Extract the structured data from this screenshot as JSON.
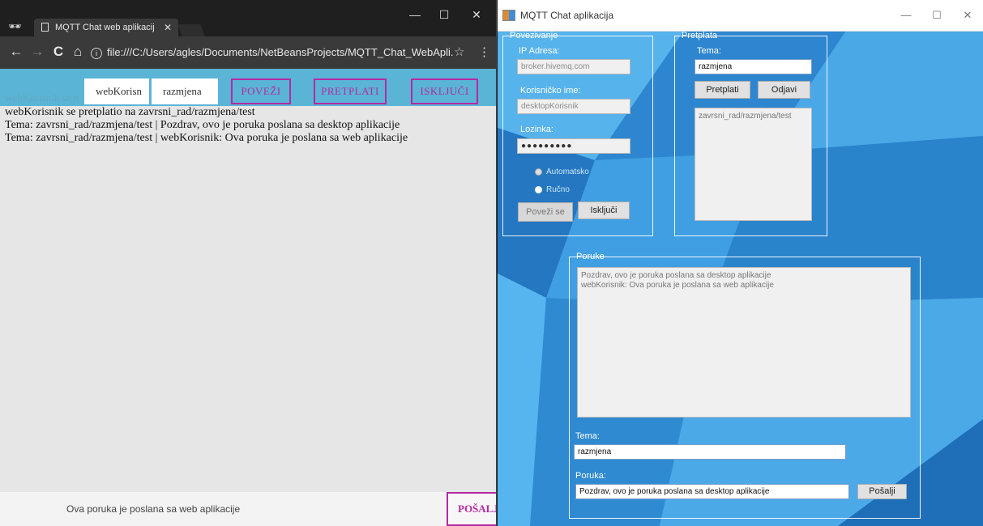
{
  "browser": {
    "tab_title": "MQTT Chat web aplikacij",
    "tab_close": "✕",
    "url": "file:///C:/Users/agles/Documents/NetBeansProjects/MQTT_Chat_WebApli...",
    "win_minimize": "—",
    "win_maximize": "☐",
    "win_close": "✕",
    "back_glyph": "←",
    "forward_glyph": "→",
    "reload_glyph": "C",
    "home_glyph": "⌂",
    "info_glyph": "i",
    "star_glyph": "☆",
    "menu_glyph": "⋮",
    "incognito_glyph": "🕶"
  },
  "webapp": {
    "ghost_text": "webKorisnik se p",
    "username_value": "webKorisn",
    "topic_value": "razmjena",
    "connect_label": "POVEŽI",
    "subscribe_label": "PRETPLATI",
    "disconnect_label": "ISKLJUČI",
    "messages": [
      "webKorisnik se pretplatio na zavrsni_rad/razmjena/test",
      "Tema: zavrsni_rad/razmjena/test | Pozdrav, ovo je poruka poslana sa desktop aplikacije",
      "Tema: zavrsni_rad/razmjena/test | webKorisnik: Ova poruka je poslana sa web aplikacije"
    ],
    "message_input_value": "Ova poruka je poslana sa web aplikacije",
    "send_label": "POŠALJI"
  },
  "desktop": {
    "title": "MQTT Chat aplikacija",
    "win_minimize": "—",
    "win_maximize": "☐",
    "win_close": "✕",
    "connection_group": {
      "title": "Povezivanje",
      "ip_label": "IP Adresa:",
      "ip_value": "broker.hivemq.com",
      "username_label": "Korisničko ime:",
      "username_value": "desktopKorisnik",
      "password_label": "Lozinka:",
      "password_value": "●●●●●●●●●",
      "radio_auto": "Automatsko",
      "radio_manual": "Ručno",
      "connect_button": "Poveži se",
      "disconnect_button": "Isključi"
    },
    "subscription_group": {
      "title": "Pretplata",
      "topic_label": "Tema:",
      "topic_value": "razmjena",
      "subscribe_button": "Pretplati",
      "unsubscribe_button": "Odjavi",
      "topics": [
        "zavrsni_rad/razmjena/test"
      ]
    },
    "messages_group": {
      "title": "Poruke",
      "messages": [
        "Pozdrav, ovo je poruka poslana sa desktop aplikacije",
        "webKorisnik:  Ova poruka je poslana sa web aplikacije"
      ],
      "topic_label": "Tema:",
      "topic_value": "razmjena",
      "message_label": "Poruka:",
      "message_value": "Pozdrav, ovo je poruka poslana sa desktop aplikacije",
      "send_button": "Pošalji"
    }
  }
}
